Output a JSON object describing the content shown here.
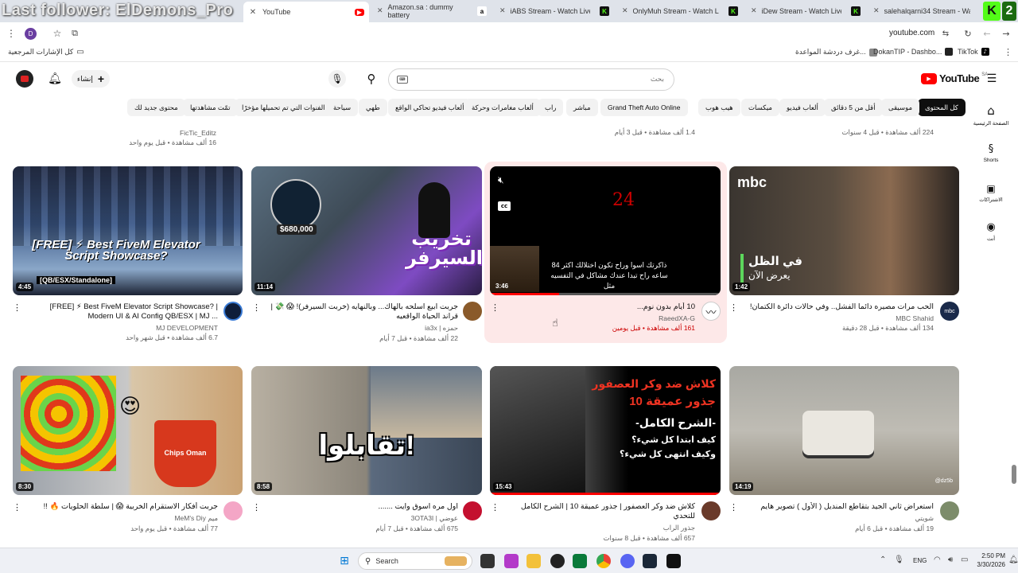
{
  "overlay_text": "Last follower: ElDemons_Pro",
  "tabs": [
    {
      "title": "YouTube"
    },
    {
      "title": "Amazon.sa : dummy battery"
    },
    {
      "title": "iABS Stream - Watch Live on Ki"
    },
    {
      "title": "OnlyMuh Stream - Watch Live"
    },
    {
      "title": "iDew Stream - Watch Live on Ki"
    },
    {
      "title": "salehalqarni34 Stream - Watch"
    }
  ],
  "k_badge_number": "2",
  "address": {
    "url": "youtube.com",
    "profile_initial": "D"
  },
  "bookmarks": {
    "all_bookmarks": "كل الإشارات المرجعية",
    "items": [
      "غرف دردشة المواعدة...",
      "DokanTIP - Dashbo...",
      "TikTok"
    ]
  },
  "youtube": {
    "logo_text": "YouTube",
    "region": "SA",
    "search_placeholder": "بحث",
    "create_label": "إنشاء",
    "chips": [
      "كل المحتوى",
      "موسيقى",
      "أقل من 5 دقائق",
      "ألعاب فيديو",
      "ميكسات",
      "هيب هوب",
      "Grand Theft Auto Online",
      "مباشر",
      "راب",
      "ألعاب مغامرات وحركة",
      "ألعاب فيديو تحاكي الواقع",
      "طهي",
      "سياحة",
      "الفنوات التي تم تحميلها مؤخرًا",
      "تمّت مشاهدتها",
      "محتوى جديد لك"
    ],
    "rail": [
      {
        "label": "الصفحة الرئيسية",
        "icon": "home-icon"
      },
      {
        "label": "Shorts",
        "icon": "shorts-icon"
      },
      {
        "label": "الاشتراكات",
        "icon": "subscriptions-icon"
      },
      {
        "label": "أنت",
        "icon": "you-icon"
      }
    ],
    "top_partial": [
      {
        "channel": "FicTic_Editz",
        "stats": "16 ألف مشاهدة • قبل يوم واحد"
      },
      {
        "channel": "",
        "stats": "1.4 ألف مشاهدة • قبل 3 أيام"
      },
      {
        "channel": "",
        "stats": "224 ألف مشاهدة • قبل 4 سنوات"
      }
    ],
    "row1": [
      {
        "title": "[FREE] ⚡ Best FiveM Elevator Script Showcase? | Modern UI & AI Config QB/ESX | MJ ...",
        "channel": "MJ DEVELOPMENT",
        "stats": "6.7 ألف مشاهدة • قبل شهر واحد",
        "duration": "4:45",
        "thumb_text": "[FREE] ⚡ Best FiveM Elevator Script Showcase?",
        "thumb_sub": "[QB/ESX/Standalone]"
      },
      {
        "title": "جربت ابيع اسلحه بالهاك... وبالنهايه (خربت السيرفر)! 😱 💸 | قراند الحياة الواقعيه",
        "channel": "حمزه | ia3x",
        "stats": "22 ألف مشاهدة • قبل 7 أيام",
        "duration": "11:14",
        "thumb_text": "تخريب السيرفر",
        "thumb_money": "$680,000"
      },
      {
        "title": "10 أيام بدون نوم...",
        "channel": "RaeedXA-G",
        "stats": "161 ألف مشاهدة • قبل يومين",
        "duration": "3:46",
        "thumb_caption": "ذاكرتك اسوا وراح تكون اختلالك اكثر 84 ساعه راح تبدا عندك مشاكل في التفسيه مثل",
        "thumb_number": "24"
      },
      {
        "title": "الحب مرات مصيره دائما الفشل.. وفي حالات دائرة الكتمان!",
        "channel": "MBC Shahid",
        "stats": "134 ألف مشاهدة • قبل 28 دقيقة",
        "duration": "1:42",
        "thumb_text": "في الظل",
        "thumb_sub": "يعرض الآن",
        "thumb_logo": "mbc"
      }
    ],
    "row2": [
      {
        "title": "جربت أفكار الاستقرام الخربية 😱 | سلطة الحلويات 🔥 !!",
        "channel": "ميم MeM's Diy",
        "stats": "77 ألف مشاهدة • قبل يوم واحد",
        "duration": "8:30",
        "thumb_text": "Chips Oman"
      },
      {
        "title": "اول مره اسوق وايت .......",
        "channel": "عوضي | 3OTA3I",
        "stats": "675 ألف مشاهدة • قبل 7 أيام",
        "duration": "8:58",
        "thumb_text": "تقابلوا!"
      },
      {
        "title": "كلاش ضد وكر العصفور | جذور عميقة 10 | الشرح الكامل للتحدي",
        "channel": "جذور الراب",
        "stats": "657 ألف مشاهدة • قبل 8 سنوات",
        "duration": "15:43",
        "thumb_lines": [
          "كلاش ضد وكر العصفور",
          "جذور عميقة 10",
          "-الشرح الكامل-",
          "كيف ابتدا كل شيء؟",
          "وكيف انتهى كل شيء؟"
        ]
      },
      {
        "title": "استعراض ثاني الجيد بتقاطع المنديل ( الأول ) تصوير هايم",
        "channel": "شويتي",
        "stats": "19 ألف مشاهدة • قبل 6 أيام",
        "duration": "14:19",
        "thumb_text": "@dz5b"
      }
    ]
  },
  "taskbar": {
    "search_label": "Search",
    "lang": "ENG",
    "time": "2:50 PM",
    "date": "3/30/2026"
  },
  "colors": {
    "yt_red": "#ff0000",
    "chip_bg": "#f2f2f2",
    "selected_chip": "#0f0f0f",
    "hover_card": "#fde8e8"
  }
}
